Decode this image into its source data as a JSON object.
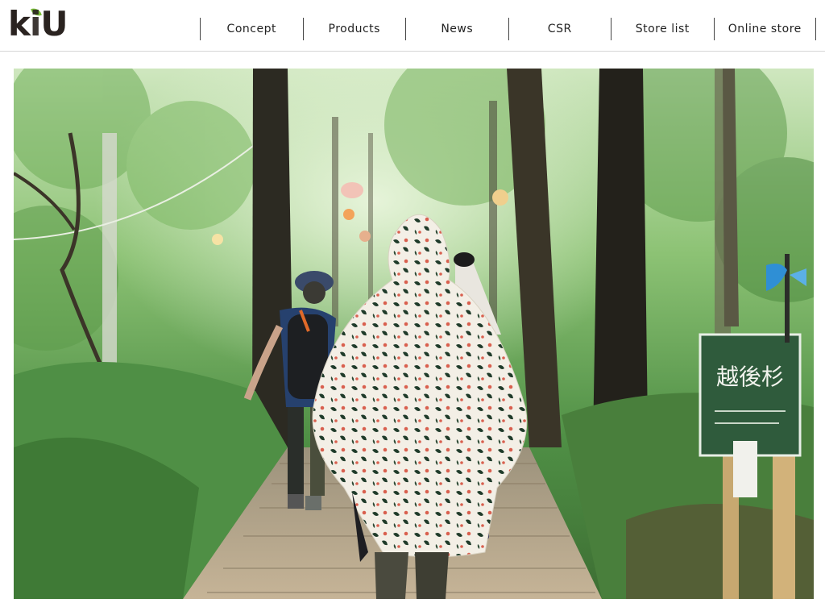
{
  "brand": {
    "logo_text_pre": "k",
    "logo_text_i": "i",
    "logo_text_post": "U",
    "leaf_color": "#7bbf3a"
  },
  "nav": {
    "items": [
      {
        "label": "Concept"
      },
      {
        "label": "Products"
      },
      {
        "label": "News"
      },
      {
        "label": "CSR"
      },
      {
        "label": "Store list"
      },
      {
        "label": "Online store"
      }
    ]
  },
  "hero": {
    "sign_text": "越後杉",
    "colors": {
      "foliage": "#4f8f45",
      "trunk": "#2c2a22",
      "boardwalk": "#b8a58a",
      "poncho_fabric": "#f3efe6",
      "poncho_print": "#1f3b2a"
    }
  }
}
